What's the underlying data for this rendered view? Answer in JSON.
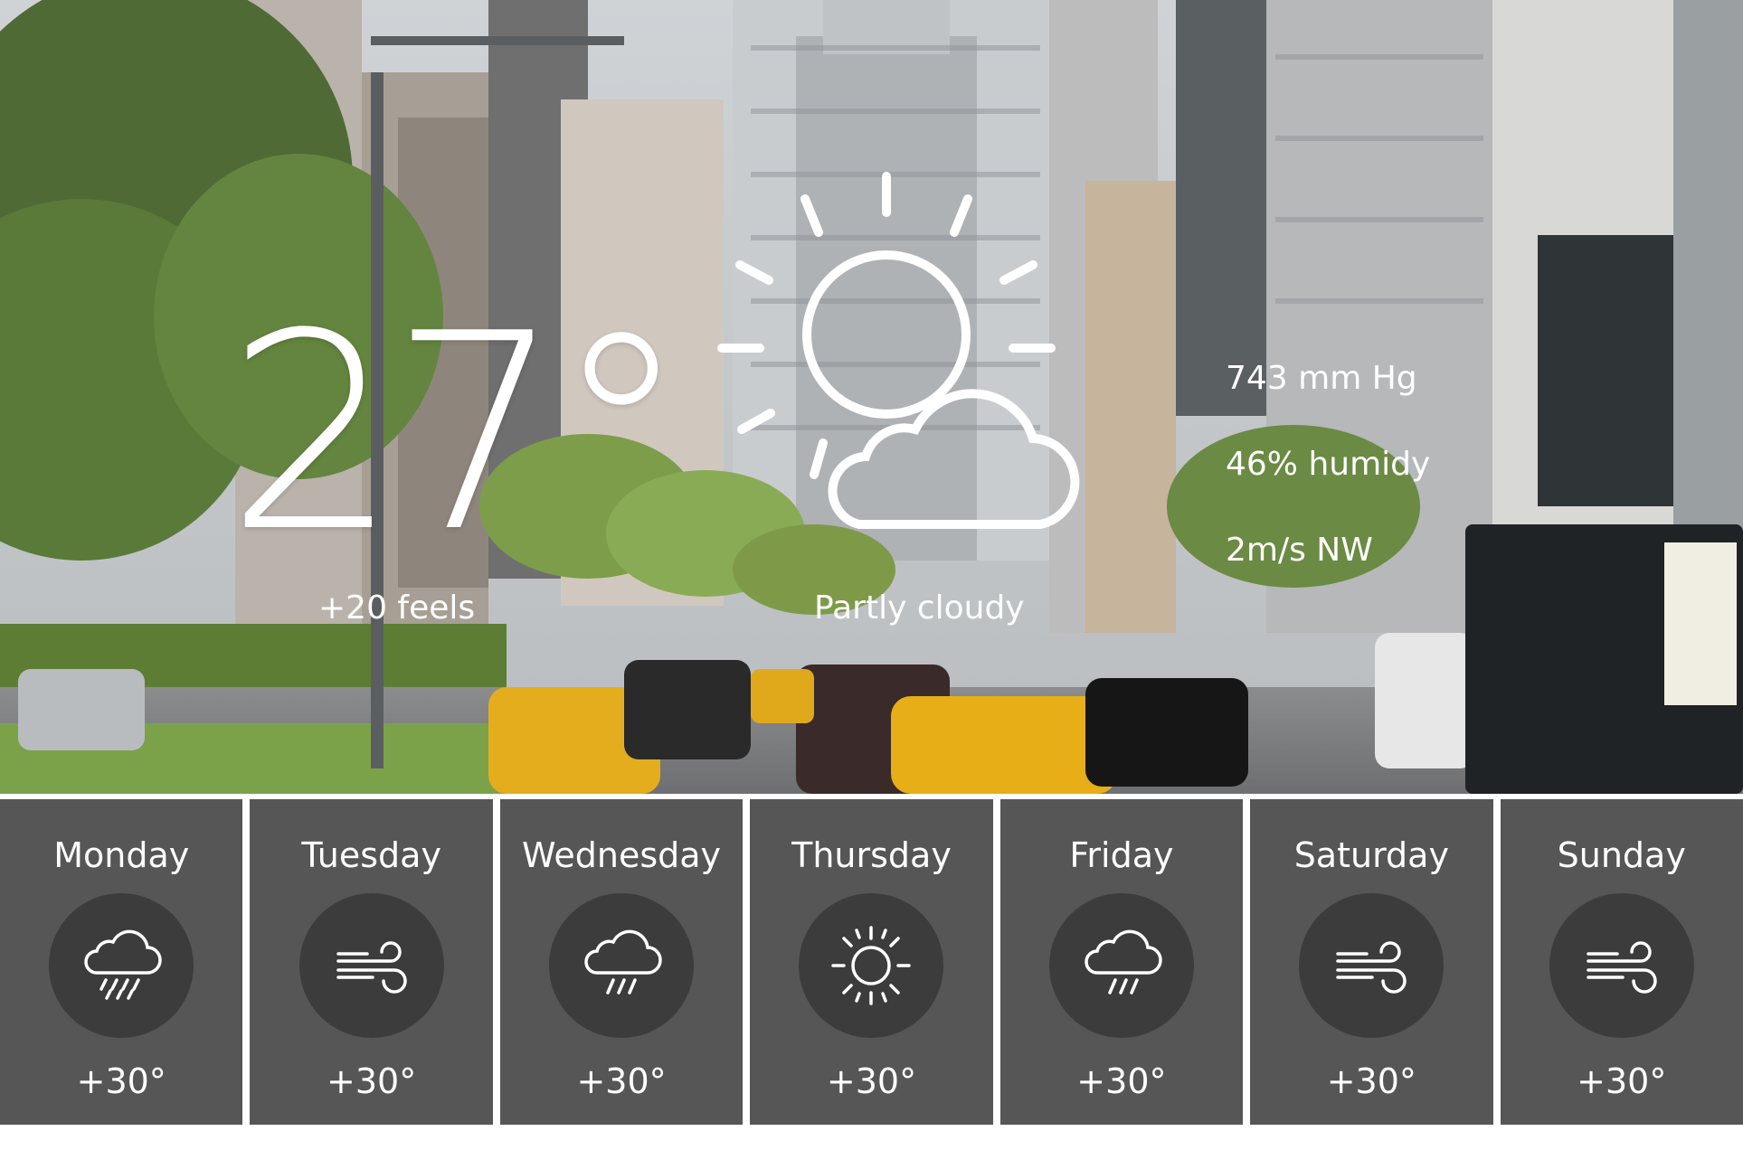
{
  "current": {
    "temperature": "27°",
    "feels": "+20 feels",
    "condition": "Partly cloudy",
    "icon": "partly-cloudy-icon",
    "pressure": "743 mm Hg",
    "humidity": "46% humidy",
    "wind": "2m/s NW"
  },
  "forecast": [
    {
      "day": "Monday",
      "icon": "rain-cloud-icon",
      "temp": "+30°"
    },
    {
      "day": "Tuesday",
      "icon": "wind-icon",
      "temp": "+30°"
    },
    {
      "day": "Wednesday",
      "icon": "rain-cloud-icon",
      "temp": "+30°"
    },
    {
      "day": "Thursday",
      "icon": "sun-icon",
      "temp": "+30°"
    },
    {
      "day": "Friday",
      "icon": "rain-cloud-icon",
      "temp": "+30°"
    },
    {
      "day": "Saturday",
      "icon": "wind-icon",
      "temp": "+30°"
    },
    {
      "day": "Sunday",
      "icon": "wind-icon",
      "temp": "+30°"
    }
  ],
  "colors": {
    "card_bg": "#565656",
    "icon_circle": "#3c3c3c",
    "text": "#ffffff"
  }
}
